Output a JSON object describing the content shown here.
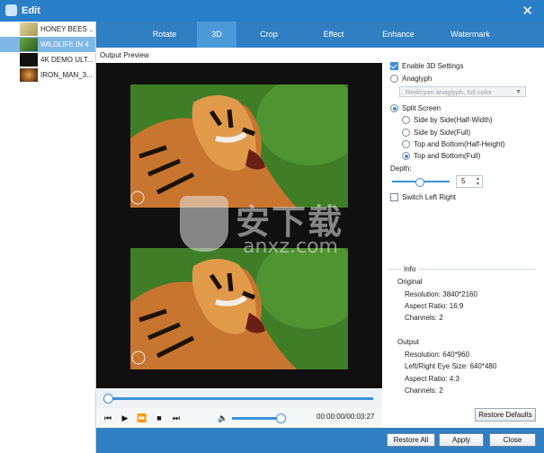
{
  "window": {
    "title": "Edit",
    "close_label": "✕"
  },
  "files": [
    {
      "name": "HONEY BEES ...",
      "selected": false,
      "thumb_color": "#c9c18a"
    },
    {
      "name": "WILDLIFE IN 4",
      "selected": true,
      "thumb_color": "#4a7f38"
    },
    {
      "name": "4K DEMO ULT...",
      "selected": false,
      "thumb_color": "#1a1a1a"
    },
    {
      "name": "IRON_MAN_3...",
      "selected": false,
      "thumb_color": "#8a3a1c"
    }
  ],
  "tabs": [
    {
      "label": "Rotate",
      "active": false
    },
    {
      "label": "3D",
      "active": true
    },
    {
      "label": "Crop",
      "active": false
    },
    {
      "label": "Effect",
      "active": false
    },
    {
      "label": "Enhance",
      "active": false
    },
    {
      "label": "Watermark",
      "active": false
    }
  ],
  "preview": {
    "label": "Output Preview"
  },
  "player": {
    "time": "00:00:00/00:03:27",
    "seek_progress": 0.0,
    "volume": 0.9,
    "icons": [
      "skip-back-icon",
      "play-icon",
      "fast-forward-icon",
      "stop-icon",
      "skip-forward-icon",
      "volume-icon"
    ]
  },
  "settings": {
    "enable_3d": {
      "label": "Enable 3D Settings",
      "checked": true
    },
    "anaglyph": {
      "label": "Anaglyph",
      "selected": false
    },
    "anaglyph_dropdown": "Red/cyan anaglyph, full color",
    "split_screen": {
      "label": "Split Screen",
      "selected": true
    },
    "split_options": [
      {
        "label": "Side by Side(Half-Width)",
        "selected": false
      },
      {
        "label": "Side by Side(Full)",
        "selected": false
      },
      {
        "label": "Top and Bottom(Half-Height)",
        "selected": false
      },
      {
        "label": "Top and Bottom(Full)",
        "selected": true
      }
    ],
    "depth_label": "Depth:",
    "depth_value": "5",
    "switch_left_right": {
      "label": "Switch Left Right",
      "checked": false
    }
  },
  "info": {
    "title": "Info",
    "original_label": "Original",
    "original": [
      "Resolution: 3840*2160",
      "Aspect Ratio: 16:9",
      "Channels: 2"
    ],
    "output_label": "Output",
    "output": [
      "Resolution: 640*960",
      "Left/Right Eye Size: 640*480",
      "Aspect Ratio: 4:3",
      "Channels: 2"
    ]
  },
  "buttons": {
    "restore_defaults": "Restore Defaults",
    "restore_all": "Restore All",
    "apply": "Apply",
    "close": "Close"
  },
  "watermark": {
    "text": "安下载",
    "sub": "anxz.com"
  },
  "colors": {
    "accent": "#2f7fc2",
    "title_bar": "#2a7fc9",
    "tab_active": "#4b9ad8"
  }
}
